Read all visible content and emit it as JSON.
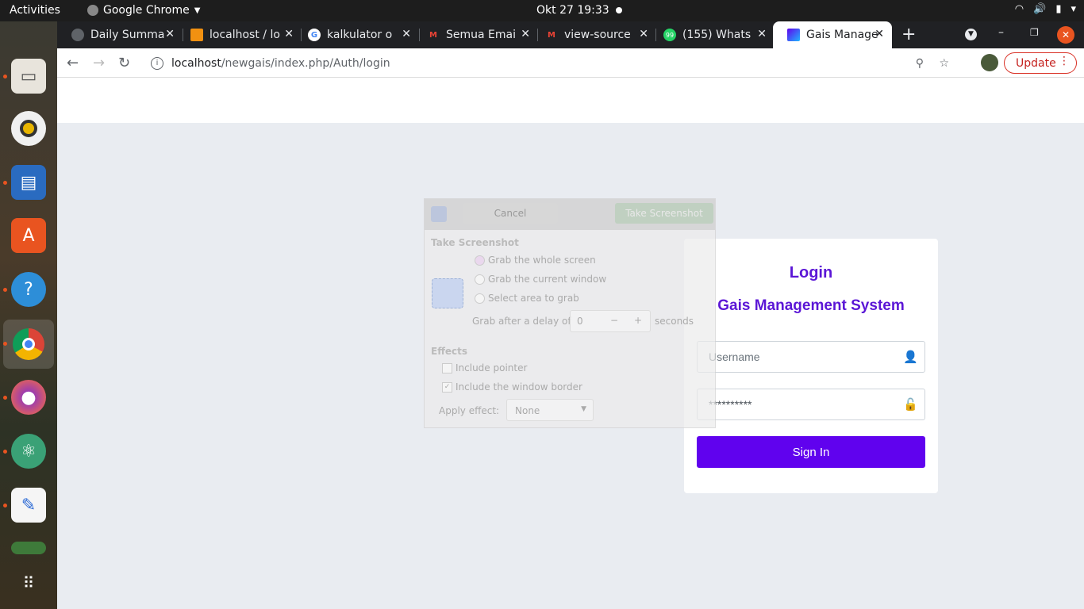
{
  "topbar": {
    "activities": "Activities",
    "app_name": "Google Chrome",
    "clock": "Okt 27  19:33"
  },
  "tabs": [
    {
      "title": "Daily Summa"
    },
    {
      "title": "localhost / lo"
    },
    {
      "title": "kalkulator o"
    },
    {
      "title": "Semua Emai"
    },
    {
      "title": "view-source"
    },
    {
      "title": "(155) Whats"
    },
    {
      "title": "Gais Manage"
    }
  ],
  "address": {
    "host": "localhost",
    "path": "/newgais/index.php/Auth/login"
  },
  "update_label": "Update",
  "login": {
    "title": "Login",
    "subtitle": "Gais Management System",
    "username_placeholder": "Username",
    "password_value": "**********",
    "signin_label": "Sign In"
  },
  "screenshot_dialog": {
    "cancel": "Cancel",
    "take": "Take Screenshot",
    "section": "Take Screenshot",
    "opt_whole": "Grab the whole screen",
    "opt_window": "Grab the current window",
    "opt_area": "Select area to grab",
    "delay_label": "Grab after a delay of",
    "delay_value": "0",
    "seconds": "seconds",
    "effects": "Effects",
    "pointer": "Include pointer",
    "border": "Include the window border",
    "apply": "Apply effect:",
    "apply_value": "None"
  },
  "colors": {
    "accent": "#6002ee",
    "title": "#5b16d6"
  }
}
